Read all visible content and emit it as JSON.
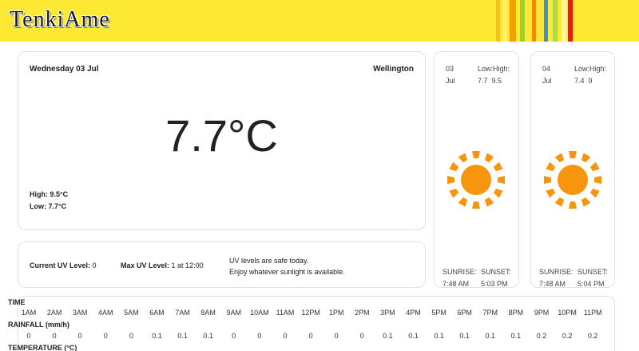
{
  "app": {
    "logo": "TenkiAme"
  },
  "stripes": [
    "#f3c221",
    "#fff06a",
    "#f59f00",
    "#9bd02e",
    "#f38a00",
    "#3a8ee0",
    "#a9dc4b",
    "#fff7a0",
    "#e81c0c"
  ],
  "current": {
    "date": "Wednesday 03 Jul",
    "location": "Wellington",
    "temperature": "7.7°C",
    "high_label": "High:",
    "high_value": "9.5°C",
    "low_label": "Low:",
    "low_value": "7.7°C"
  },
  "uv": {
    "current_label": "Current UV Level:",
    "current_value": "0",
    "max_label": "Max UV Level:",
    "max_value": "1 at 12:00",
    "message_line1": "UV levels are safe today.",
    "message_line2": "Enjoy whatever sunlight is available."
  },
  "forecast": [
    {
      "day": "03",
      "month": "Jul",
      "lowhigh_label": "Low:High:",
      "low": "7.7",
      "high": "9.5",
      "icon": "sun-icon",
      "sunrise_label": "SUNRISE:",
      "sunrise": "7:48 AM",
      "sunset_label": "SUNSET:",
      "sunset": "5:03 PM"
    },
    {
      "day": "04",
      "month": "Jul",
      "lowhigh_label": "Low:High:",
      "low": "7.4",
      "high": "9",
      "icon": "sun-icon",
      "sunrise_label": "SUNRISE:",
      "sunrise": "7:48 AM",
      "sunset_label": "SUNSET:",
      "sunset": "5:04 PM"
    }
  ],
  "hourly": {
    "time_label": "TIME",
    "rain_label": "RAINFALL (mm/h)",
    "temp_label": "TEMPERATURE (°C)",
    "times": [
      "1AM",
      "2AM",
      "3AM",
      "4AM",
      "5AM",
      "6AM",
      "7AM",
      "8AM",
      "9AM",
      "10AM",
      "11AM",
      "12PM",
      "1PM",
      "2PM",
      "3PM",
      "4PM",
      "5PM",
      "6PM",
      "7PM",
      "8PM",
      "9PM",
      "10PM",
      "11PM"
    ],
    "rainfall": [
      "0",
      "0",
      "0",
      "0",
      "0",
      "0.1",
      "0.1",
      "0.1",
      "0",
      "0",
      "0",
      "0",
      "0",
      "0",
      "0.1",
      "0.1",
      "0.1",
      "0.1",
      "0.1",
      "0.1",
      "0.2",
      "0.2",
      "0.2"
    ]
  },
  "colors": {
    "header_bg": "#fde834",
    "sun": "#f7960e"
  }
}
